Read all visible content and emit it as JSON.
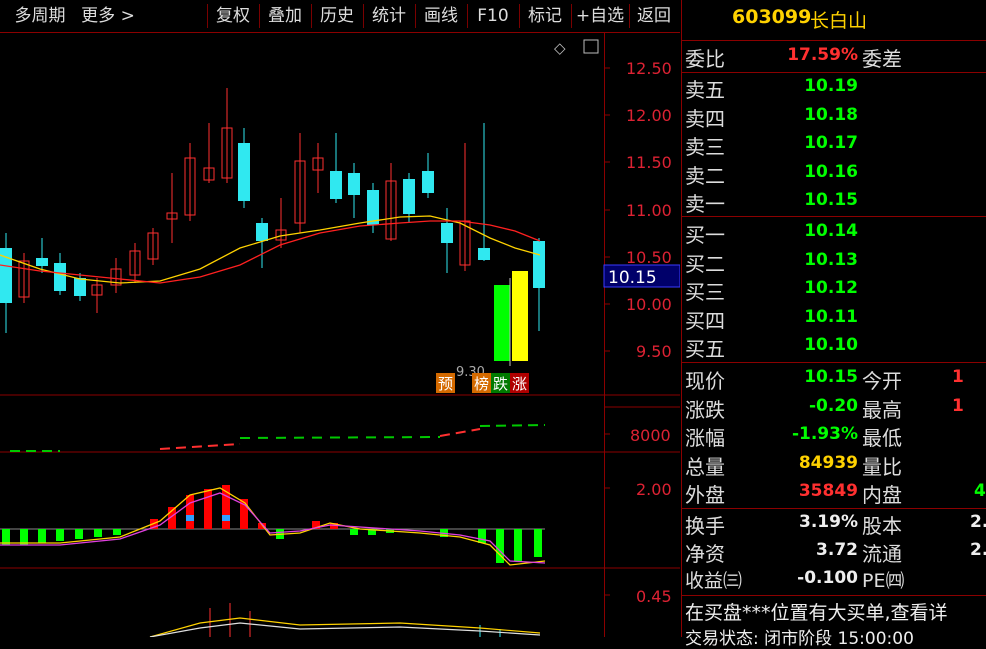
{
  "toolbar": {
    "items": [
      "多周期",
      "更多 >",
      "复权",
      "叠加",
      "历史",
      "统计",
      "画线",
      "F10",
      "标记",
      "+自选",
      "返回"
    ]
  },
  "chart": {
    "price_ticks": [
      "12.50",
      "12.00",
      "11.50",
      "11.00",
      "10.50",
      "10.00",
      "9.50"
    ],
    "current_price_label": "10.15",
    "low_annotation": "9.30",
    "badges": [
      "预",
      "榜",
      "跌",
      "涨"
    ],
    "volume_tick": "8000",
    "macd_tick": "2.00",
    "bottom_tick": "0.45",
    "colors": {
      "up": "#ff3030",
      "down": "#30e8f0",
      "ma1": "#ffd200",
      "ma2": "#ff2020",
      "axis": "#8b0000"
    }
  },
  "quote": {
    "code": "603099",
    "name": "长白山",
    "weibi_label": "委比",
    "weibi_value": "17.59%",
    "weicha_label": "委差",
    "sell": [
      {
        "label": "卖五",
        "price": "10.19"
      },
      {
        "label": "卖四",
        "price": "10.18"
      },
      {
        "label": "卖三",
        "price": "10.17"
      },
      {
        "label": "卖二",
        "price": "10.16"
      },
      {
        "label": "卖一",
        "price": "10.15"
      }
    ],
    "buy": [
      {
        "label": "买一",
        "price": "10.14"
      },
      {
        "label": "买二",
        "price": "10.13"
      },
      {
        "label": "买三",
        "price": "10.12"
      },
      {
        "label": "买四",
        "price": "10.11"
      },
      {
        "label": "买五",
        "price": "10.10"
      }
    ],
    "stats": [
      {
        "label": "现价",
        "value": "10.15",
        "label2": "今开",
        "value2": "1"
      },
      {
        "label": "涨跌",
        "value": "-0.20",
        "label2": "最高",
        "value2": "1"
      },
      {
        "label": "涨幅",
        "value": "-1.93%",
        "label2": "最低",
        "value2": ""
      },
      {
        "label": "总量",
        "value": "84939",
        "label2": "量比",
        "value2": ""
      },
      {
        "label": "外盘",
        "value": "35849",
        "label2": "内盘",
        "value2": "4"
      }
    ],
    "stats2": [
      {
        "label": "换手",
        "value": "3.19%",
        "label2": "股本",
        "value2": "2."
      },
      {
        "label": "净资",
        "value": "3.72",
        "label2": "流通",
        "value2": "2."
      },
      {
        "label": "收益㈢",
        "value": "-0.100",
        "label2": "PE㈣",
        "value2": ""
      }
    ],
    "message1": "在买盘***位置有大买单,查看详",
    "message2": "交易状态: 闭市阶段 15:00:00"
  }
}
